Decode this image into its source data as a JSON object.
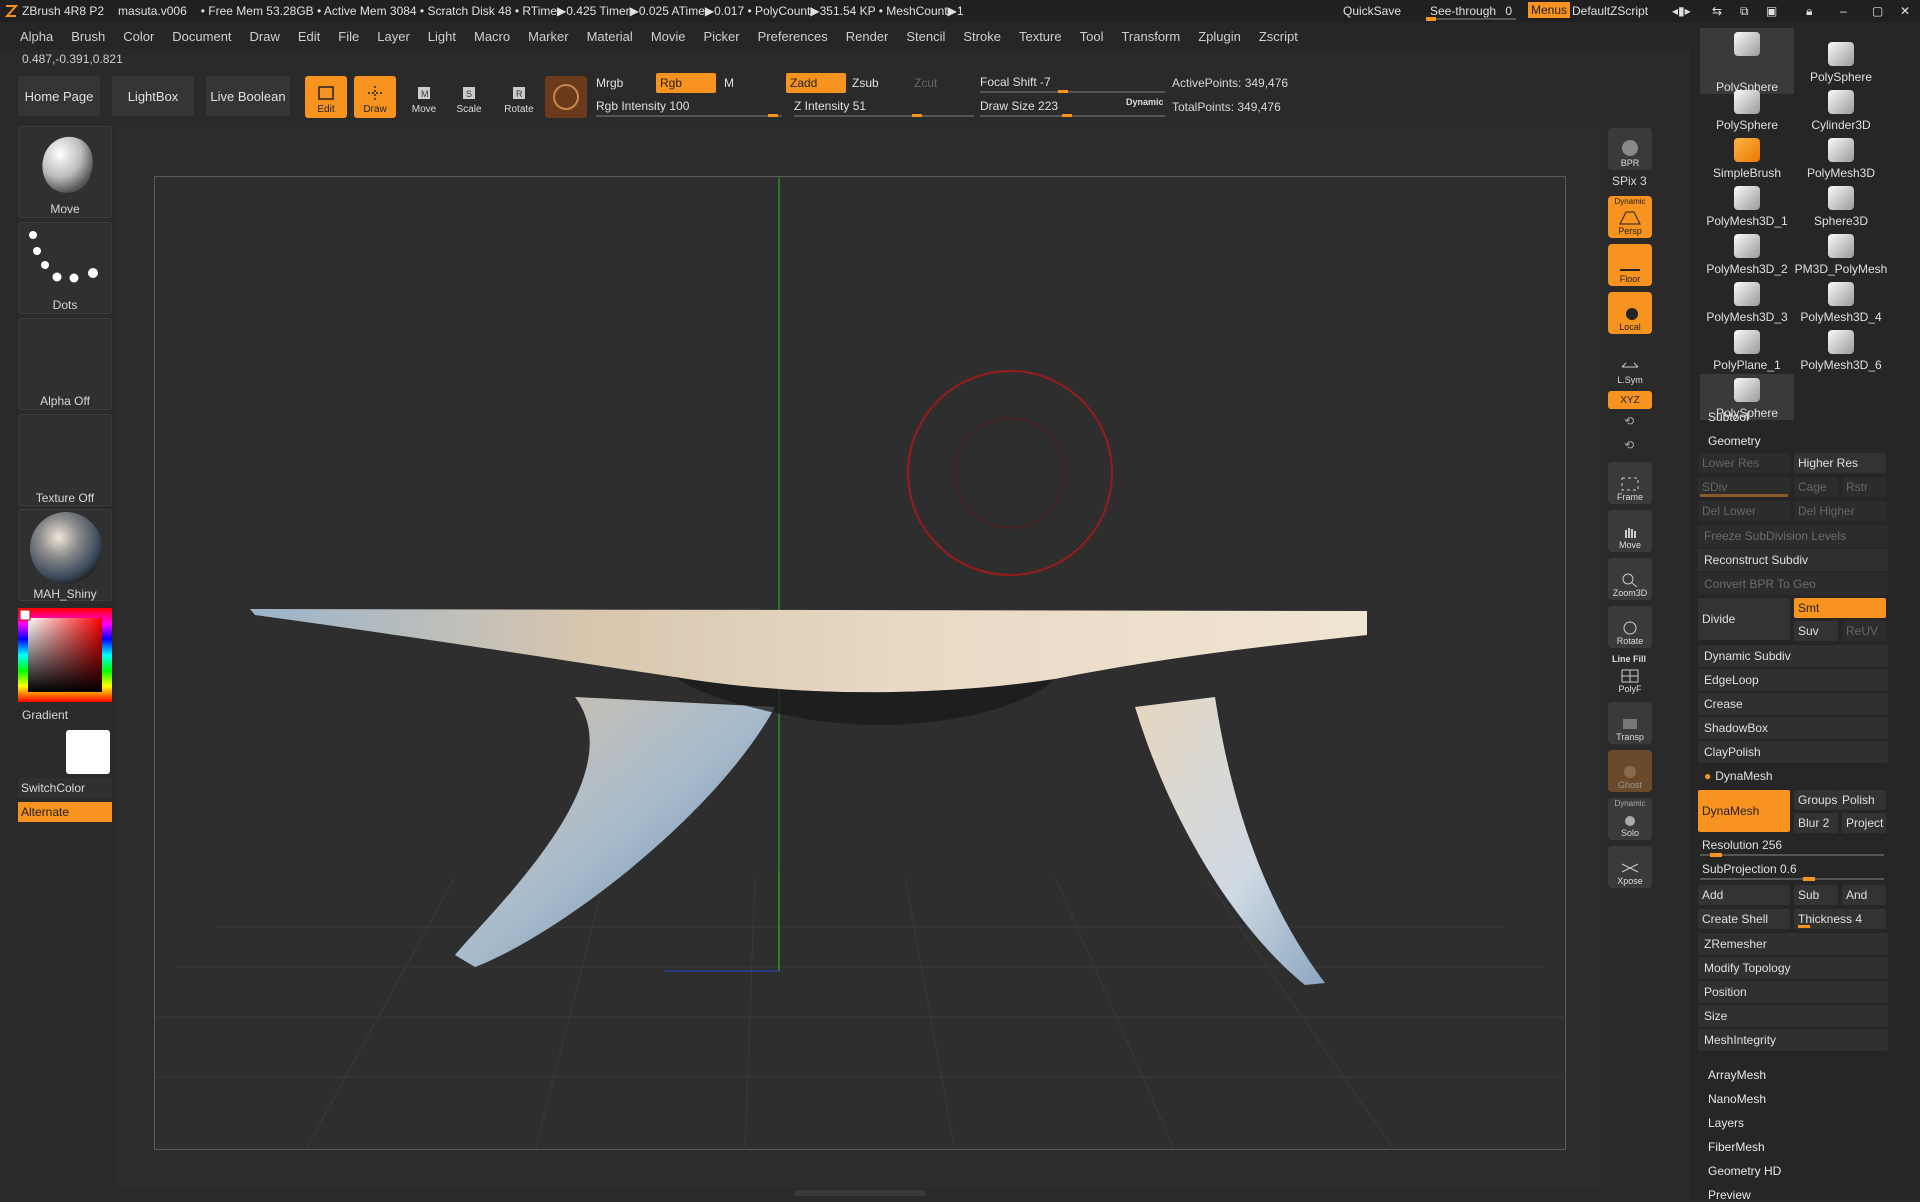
{
  "titlebar": {
    "app": "ZBrush 4R8 P2",
    "doc": "masuta.v006",
    "stats": "• Free Mem 53.28GB • Active Mem 3084 • Scratch Disk 48 • RTime▶0.425 Timer▶0.025 ATime▶0.017 • PolyCount▶351.54 KP • MeshCount▶1",
    "quicksave": "QuickSave",
    "seethrough": "See-through",
    "seethrough_value": "0",
    "menus": "Menus",
    "script": "DefaultZScript"
  },
  "menubar": [
    "Alpha",
    "Brush",
    "Color",
    "Document",
    "Draw",
    "Edit",
    "File",
    "Layer",
    "Light",
    "Macro",
    "Marker",
    "Material",
    "Movie",
    "Picker",
    "Preferences",
    "Render",
    "Stencil",
    "Stroke",
    "Texture",
    "Tool",
    "Transform",
    "Zplugin",
    "Zscript"
  ],
  "coords": "0.487,-0.391,0.821",
  "shelf": {
    "home": "Home Page",
    "lightbox": "LightBox",
    "liveboolean": "Live Boolean",
    "edit": "Edit",
    "draw": "Draw",
    "move": "Move",
    "scale": "Scale",
    "rotate": "Rotate",
    "mrgb": "Mrgb",
    "rgb": "Rgb",
    "m": "M",
    "zadd": "Zadd",
    "zsub": "Zsub",
    "zcut": "Zcut",
    "rgb_intensity": "Rgb Intensity 100",
    "z_intensity": "Z Intensity 51",
    "focal_shift": "Focal Shift -7",
    "draw_size": "Draw Size 223",
    "dynamic": "Dynamic",
    "active_points": "ActivePoints: 349,476",
    "total_points": "TotalPoints: 349,476"
  },
  "left": {
    "brush": "Move",
    "stroke": "Dots",
    "alpha": "Alpha Off",
    "texture": "Texture Off",
    "material": "MAH_Shiny",
    "gradient": "Gradient",
    "switchcolor": "SwitchColor",
    "alternate": "Alternate"
  },
  "vtools": {
    "bpr": "BPR",
    "spix": "SPix 3",
    "dynamic": "Dynamic",
    "persp": "Persp",
    "floor": "Floor",
    "local": "Local",
    "lsym": "L.Sym",
    "xyz": "XYZ",
    "frame": "Frame",
    "move": "Move",
    "zoom3d": "Zoom3D",
    "rotate": "Rotate",
    "linefill": "Line Fill",
    "polyf": "PolyF",
    "transp": "Transp",
    "ghost": "Ghost",
    "solo": "Solo",
    "xpose": "Xpose"
  },
  "tools": [
    {
      "label": "PolySphere"
    },
    {
      "label": "PolySphere"
    },
    {
      "label": "PolySphere"
    },
    {
      "label": "Cylinder3D"
    },
    {
      "label": "SimpleBrush"
    },
    {
      "label": "PolyMesh3D"
    },
    {
      "label": "PolyMesh3D_1"
    },
    {
      "label": "Sphere3D"
    },
    {
      "label": "PolyMesh3D_2"
    },
    {
      "label": "PM3D_PolyMesh"
    },
    {
      "label": "PolyMesh3D_3"
    },
    {
      "label": "PolyMesh3D_4"
    },
    {
      "label": "PolyPlane_1"
    },
    {
      "label": "PolyMesh3D_6"
    },
    {
      "label": "PolySphere"
    }
  ],
  "geometry": {
    "subtool": "Subtool",
    "geometry": "Geometry",
    "lower_res": "Lower Res",
    "higher_res": "Higher Res",
    "sdiv": "SDiv",
    "cage": "Cage",
    "rstr": "Rstr",
    "del_lower": "Del Lower",
    "del_higher": "Del Higher",
    "freeze": "Freeze SubDivision Levels",
    "reconstruct": "Reconstruct Subdiv",
    "convert_bpr": "Convert BPR To Geo",
    "divide": "Divide",
    "smt": "Smt",
    "suv": "Suv",
    "reuv": "ReUV",
    "dynamic_subdiv": "Dynamic Subdiv",
    "edgeloop": "EdgeLoop",
    "crease": "Crease",
    "shadowbox": "ShadowBox",
    "claypolish": "ClayPolish",
    "dynamesh_head": "DynaMesh",
    "dynamesh_btn": "DynaMesh",
    "groups": "Groups",
    "polish": "Polish",
    "blur": "Blur 2",
    "project": "Project",
    "resolution": "Resolution 256",
    "subprojection": "SubProjection 0.6",
    "add": "Add",
    "sub": "Sub",
    "and": "And",
    "create_shell": "Create Shell",
    "thickness": "Thickness 4",
    "zremesher": "ZRemesher",
    "modify_topology": "Modify Topology",
    "position": "Position",
    "size": "Size",
    "meshintegrity": "MeshIntegrity"
  },
  "subpalettes": [
    "ArrayMesh",
    "NanoMesh",
    "Layers",
    "FiberMesh",
    "Geometry HD",
    "Preview"
  ],
  "colors": {
    "accent": "#f7931e",
    "bg": "#2a2a2a",
    "panel": "#262626"
  }
}
